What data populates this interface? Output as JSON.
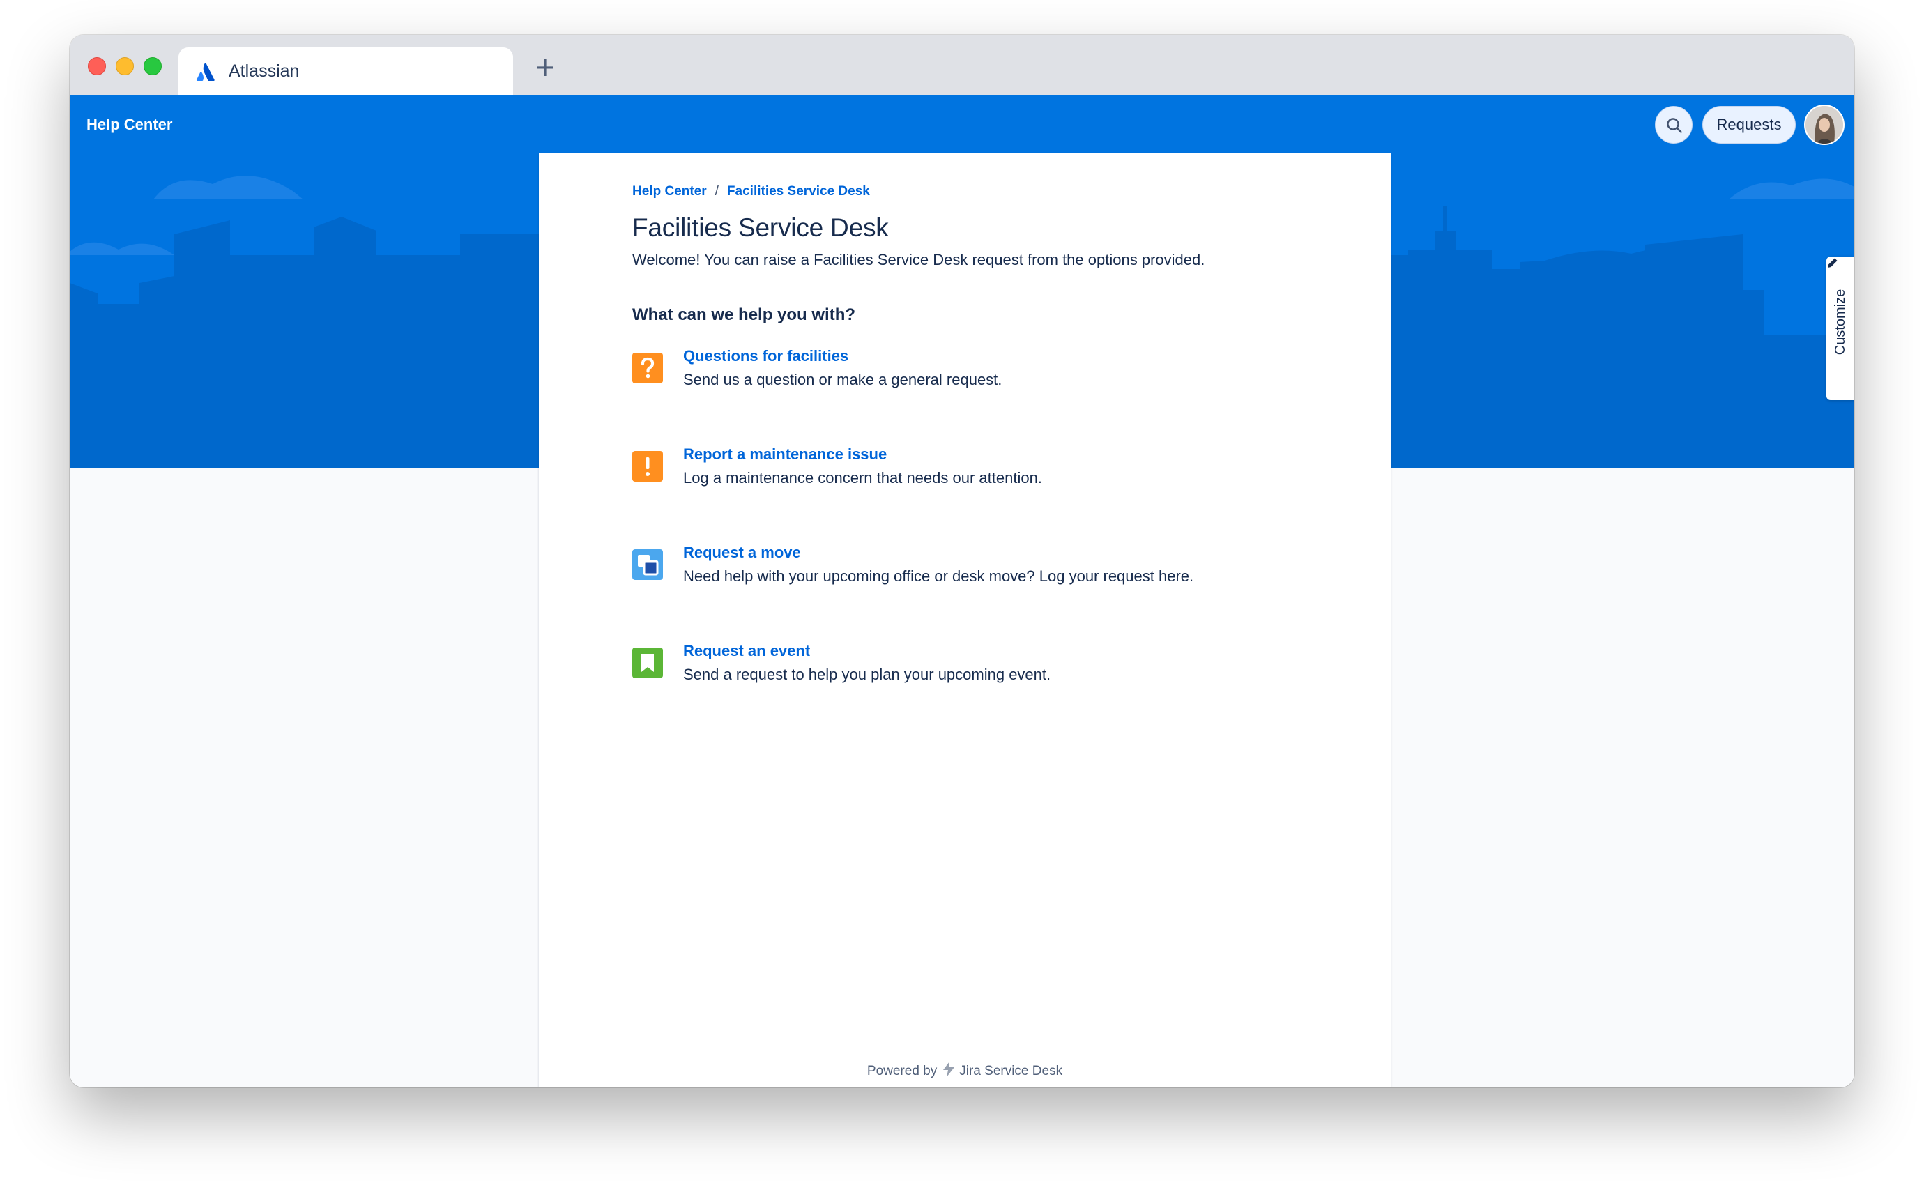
{
  "browser": {
    "tab_title": "Atlassian",
    "new_tab_label": "+"
  },
  "header": {
    "brand": "Help Center",
    "requests_label": "Requests",
    "customize_label": "Customize"
  },
  "breadcrumb": {
    "home": "Help Center",
    "separator": "/",
    "current": "Facilities Service Desk"
  },
  "main": {
    "title": "Facilities Service Desk",
    "welcome": "Welcome! You can raise a Facilities Service Desk request from the options provided.",
    "help_heading": "What can we help you with?",
    "options": [
      {
        "title": "Questions for facilities",
        "description": "Send us a question or make a general request.",
        "icon": "question-icon",
        "color": "#ff8f1f"
      },
      {
        "title": "Report a maintenance issue",
        "description": "Log a maintenance concern that needs our attention.",
        "icon": "exclamation-icon",
        "color": "#ff8f1f"
      },
      {
        "title": "Request a move",
        "description": "Need help with your upcoming office or desk move? Log your request here.",
        "icon": "move-icon",
        "color": "#4ba7ee"
      },
      {
        "title": "Request an event",
        "description": "Send a request to help you plan your upcoming event.",
        "icon": "bookmark-icon",
        "color": "#5bb636"
      }
    ]
  },
  "footer": {
    "powered_by": "Powered by",
    "product": "Jira Service Desk"
  },
  "colors": {
    "header_blue": "#0074e0",
    "link_blue": "#0065d9",
    "text": "#172b4d"
  }
}
